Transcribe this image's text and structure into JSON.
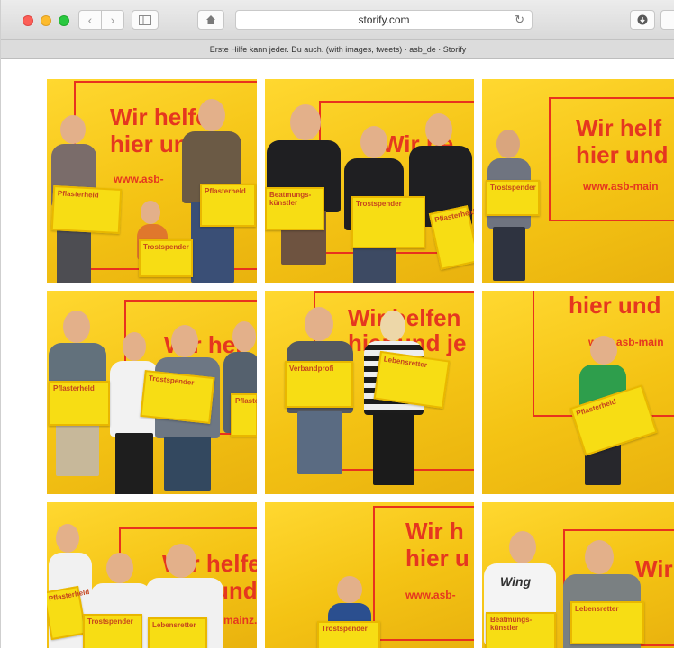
{
  "browser": {
    "url": "storify.com",
    "tab_title": "Erste Hilfe kann jeder. Du auch. (with images, tweets) · asb_de · Storify"
  },
  "photos": [
    {
      "poster_line1": "Wir helfen",
      "poster_line2": "hier und",
      "poster_url": "www.asb-",
      "signs": [
        "Pflasterheld",
        "Trostspender"
      ]
    },
    {
      "poster_line1": "Wir he",
      "poster_line2": "",
      "poster_url": "",
      "signs": [
        "Beatmungs- künstler",
        "Trostspender",
        "Pflasterheld"
      ]
    },
    {
      "poster_line1": "Wir helf",
      "poster_line2": "hier und",
      "poster_url": "www.asb-main",
      "signs": [
        "Trostspender"
      ]
    },
    {
      "poster_line1": "Wir hel",
      "poster_line2": "",
      "poster_url": "",
      "signs": [
        "Pflasterheld",
        "Trostspender",
        "Pflasterheld"
      ]
    },
    {
      "poster_line1": "Wir helfen",
      "poster_line2": "hier und je",
      "poster_url": "",
      "signs": [
        "Verbandprofi",
        "Lebensretter"
      ]
    },
    {
      "poster_line1": "hier und",
      "poster_line2": "",
      "poster_url": "www.asb-main",
      "signs": [
        "Pflasterheld"
      ]
    },
    {
      "poster_line1": "Wir helfe",
      "poster_line2": "und",
      "poster_url": "mainz.",
      "signs": [
        "Pflasterheld",
        "Trostspender",
        "Lebensretter"
      ]
    },
    {
      "poster_line1": "Wir h",
      "poster_line2": "hier u",
      "poster_url": "www.asb-",
      "signs": [
        "Trostspender"
      ]
    },
    {
      "poster_line1": "Wir he",
      "poster_line2": "",
      "poster_url": "",
      "signs": [
        "Beatmungs- künstler",
        "Lebensretter"
      ]
    }
  ],
  "shirt_texts": {
    "wing": "Wing"
  },
  "colors": {
    "poster_red": "#e5371f",
    "background_yellow": "#f4c314",
    "sign_yellow": "#f7dd14"
  }
}
